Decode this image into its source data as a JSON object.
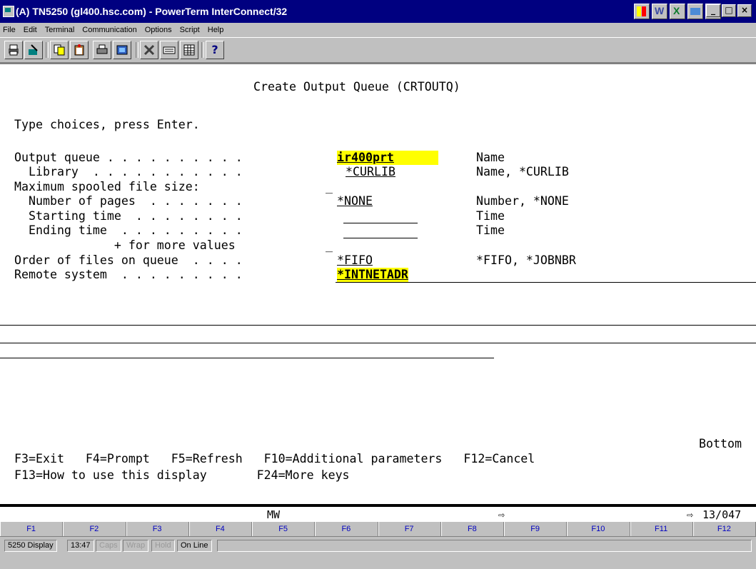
{
  "window": {
    "title": "(A) TN5250 (gl400.hsc.com) - PowerTerm InterConnect/32",
    "controls": [
      "_",
      "□",
      "×"
    ]
  },
  "menu": [
    "File",
    "Edit",
    "Terminal",
    "Communication",
    "Options",
    "Script",
    "Help"
  ],
  "toolbar": {
    "buttons": [
      "print-icon",
      "wizard-icon",
      "copy-icon",
      "paste-icon",
      "printer-icon",
      "image-icon",
      "tools-icon",
      "keyboard-icon",
      "grid-icon",
      "help-icon"
    ],
    "help_glyph": "?"
  },
  "screen": {
    "title": "Create Output Queue (CRTOUTQ)",
    "instruction": "Type choices, press Enter.",
    "fields": [
      {
        "label": "Output queue . . . . . . . . . .",
        "value": "ir400prt",
        "hint": "Name"
      },
      {
        "label": "  Library  . . . . . . . . . . .",
        "value": "*CURLIB",
        "hint": "Name, *CURLIB"
      },
      {
        "label": "Maximum spooled file size:",
        "value": "_",
        "hint": ""
      },
      {
        "label": "  Number of pages  . . . . . . .",
        "value": "*NONE",
        "hint": "Number, *NONE"
      },
      {
        "label": "  Starting time  . . . . . . . .",
        "value": "",
        "hint": "Time"
      },
      {
        "label": "  Ending time  . . . . . . . . .",
        "value": "",
        "hint": "Time"
      },
      {
        "label": "              + for more values",
        "value": "_",
        "hint": ""
      },
      {
        "label": "Order of files on queue  . . . .",
        "value": "*FIFO",
        "hint": "*FIFO, *JOBNBR"
      },
      {
        "label": "Remote system  . . . . . . . . .",
        "value": "*INTNETADR",
        "hint": ""
      }
    ],
    "more": "Bottom",
    "fkeys_line1": "F3=Exit   F4=Prompt   F5=Refresh   F10=Additional parameters   F12=Cancel",
    "fkeys_line2": "F13=How to use this display       F24=More keys"
  },
  "status": {
    "indicator": "MW",
    "arrow": "⇨",
    "cursor_arrow": "⇨",
    "position": "13/047"
  },
  "fkeys": [
    "F1",
    "F2",
    "F3",
    "F4",
    "F5",
    "F6",
    "F7",
    "F8",
    "F9",
    "F10",
    "F11",
    "F12"
  ],
  "bottom": {
    "mode": "5250 Display",
    "time": "13:47",
    "caps": "Caps",
    "wrap": "Wrap",
    "hold": "Hold",
    "online": "On Line"
  }
}
